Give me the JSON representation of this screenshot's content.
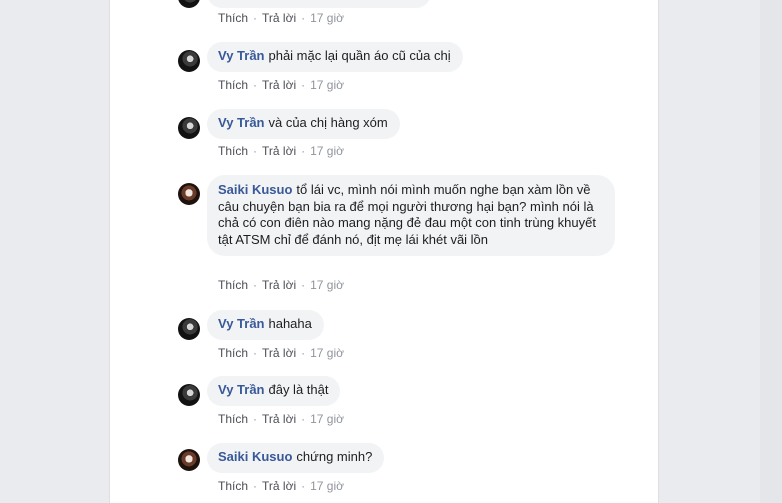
{
  "comments": [
    {
      "id": "c0",
      "author": "",
      "text": "",
      "avatar": "none",
      "like_label": "Thích",
      "reply_label": "Trả lời",
      "time": "17 giờ"
    },
    {
      "id": "c1",
      "author": "Vy Trần",
      "text": "phải mặc lại quần áo cũ của chị",
      "avatar": "vy-avatar",
      "like_label": "Thích",
      "reply_label": "Trả lời",
      "time": "17 giờ"
    },
    {
      "id": "c2",
      "author": "Vy Trần",
      "text": "và của chị hàng xóm",
      "avatar": "vy-avatar",
      "like_label": "Thích",
      "reply_label": "Trả lời",
      "time": "17 giờ"
    },
    {
      "id": "c3",
      "author": "Saiki Kusuo",
      "text": "tổ lái vc, mình nói mình muốn nghe bạn xàm lồn về câu chuyện bạn bia ra để mọi người thương hại bạn? mình nói là chả có con điên nào mang nặng đẻ đau một con tinh trùng khuyết tật ATSM chỉ để đánh nó, địt mẹ lái khét vãi lồn",
      "avatar": "saiki-avatar",
      "like_label": "Thích",
      "reply_label": "Trả lời",
      "time": "17 giờ"
    },
    {
      "id": "c4",
      "author": "Vy Trần",
      "text": "hahaha",
      "avatar": "vy-avatar",
      "like_label": "Thích",
      "reply_label": "Trả lời",
      "time": "17 giờ"
    },
    {
      "id": "c5",
      "author": "Vy Trần",
      "text": "đây là thật",
      "avatar": "vy-avatar",
      "like_label": "Thích",
      "reply_label": "Trả lời",
      "time": "17 giờ"
    },
    {
      "id": "c6",
      "author": "Saiki Kusuo",
      "text": "chứng minh?",
      "avatar": "saiki-avatar",
      "like_label": "Thích",
      "reply_label": "Trả lời",
      "time": "17 giờ"
    }
  ],
  "colors": {
    "page_bg": "#e9ebee",
    "panel_bg": "#ffffff",
    "bubble_bg": "#f2f3f5",
    "author": "#385898",
    "action": "#606770"
  }
}
